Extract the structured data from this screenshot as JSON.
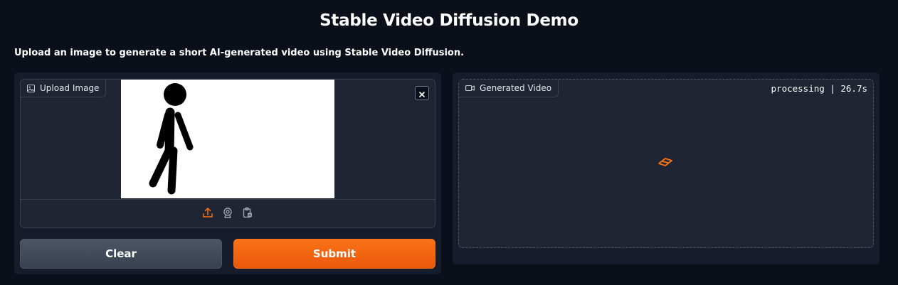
{
  "page": {
    "title": "Stable Video Diffusion Demo",
    "description": "Upload an image to generate a short AI-generated video using Stable Video Diffusion."
  },
  "upload": {
    "label": "Upload Image",
    "label_icon": "image-icon",
    "toolbar_icons": [
      "upload-icon",
      "webcam-icon",
      "clipboard-icon"
    ]
  },
  "buttons": {
    "clear_label": "Clear",
    "submit_label": "Submit"
  },
  "output": {
    "label": "Generated Video",
    "label_icon": "video-icon",
    "status": "processing | 26.7s"
  },
  "colors": {
    "background": "#0b0f19",
    "panel": "#161c2b",
    "block": "#1f2533",
    "accent": "#f97316",
    "secondary_button": "#4b5563"
  }
}
